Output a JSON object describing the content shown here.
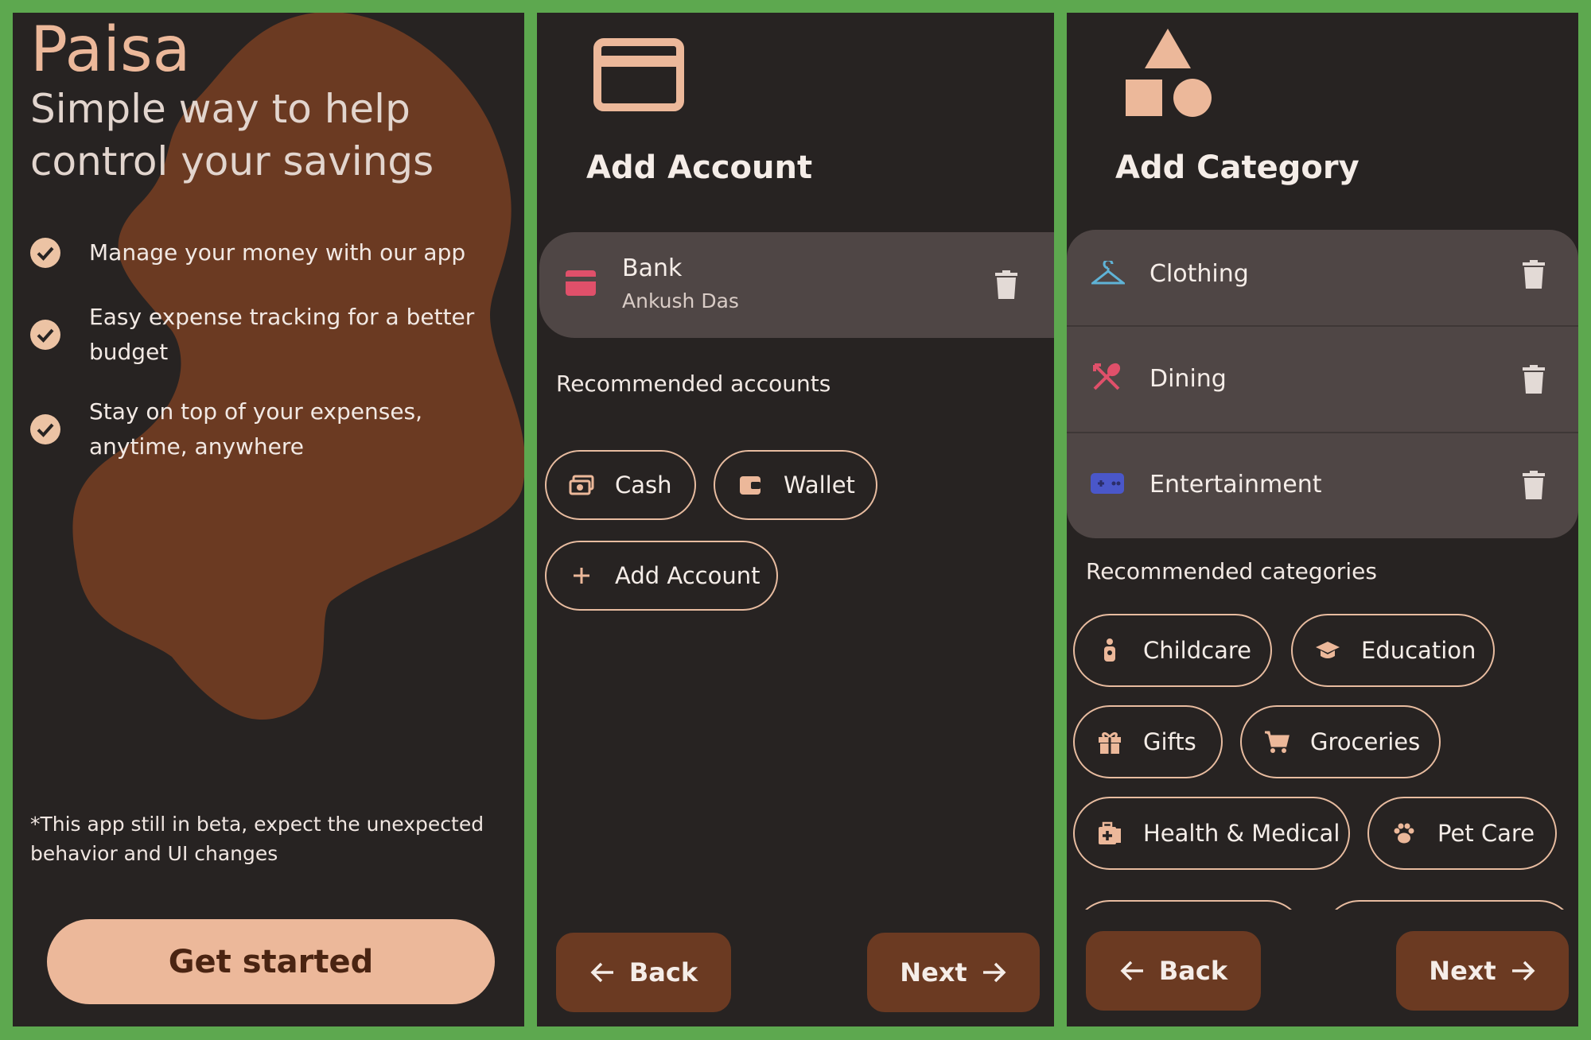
{
  "onboarding": {
    "app_name": "Paisa",
    "tagline": "Simple way to help control your savings",
    "features": [
      {
        "text": "Manage your money with our app",
        "icon": "check-circle-icon"
      },
      {
        "text": "Easy expense tracking for a better budget",
        "icon": "check-circle-icon"
      },
      {
        "text": "Stay on top of your expenses, anytime, anywhere",
        "icon": "check-circle-icon"
      }
    ],
    "beta_note": "*This app still in beta, expect the unexpected behavior and UI changes",
    "cta_label": "Get started"
  },
  "add_account": {
    "title": "Add Account",
    "header_icon": "credit-card-icon",
    "accounts": [
      {
        "name": "Bank",
        "holder": "Ankush Das",
        "icon": "card-icon",
        "color": "#e0506a"
      }
    ],
    "recommended_label": "Recommended accounts",
    "recommended": [
      {
        "label": "Cash",
        "icon": "cash-icon"
      },
      {
        "label": "Wallet",
        "icon": "wallet-icon"
      }
    ],
    "add_button_label": "Add Account",
    "back_label": "Back",
    "next_label": "Next"
  },
  "add_category": {
    "title": "Add Category",
    "header_icon": "shapes-icon",
    "categories": [
      {
        "name": "Clothing",
        "icon": "hanger-icon",
        "color": "#5fb3d6"
      },
      {
        "name": "Dining",
        "icon": "utensils-icon",
        "color": "#e0506a"
      },
      {
        "name": "Entertainment",
        "icon": "gamepad-icon",
        "color": "#4a57c9"
      }
    ],
    "recommended_label": "Recommended categories",
    "recommended": [
      {
        "label": "Childcare",
        "icon": "child-icon"
      },
      {
        "label": "Education",
        "icon": "graduation-cap-icon"
      },
      {
        "label": "Gifts",
        "icon": "gift-icon"
      },
      {
        "label": "Groceries",
        "icon": "cart-icon"
      },
      {
        "label": "Health & Medical",
        "icon": "medical-icon"
      },
      {
        "label": "Pet Care",
        "icon": "paw-icon"
      }
    ],
    "back_label": "Back",
    "next_label": "Next"
  },
  "colors": {
    "frame": "#5da84f",
    "background": "#272322",
    "accent": "#ecb89a",
    "button": "#6b3a22",
    "card": "#4f4645",
    "blob": "#6b3a22"
  }
}
